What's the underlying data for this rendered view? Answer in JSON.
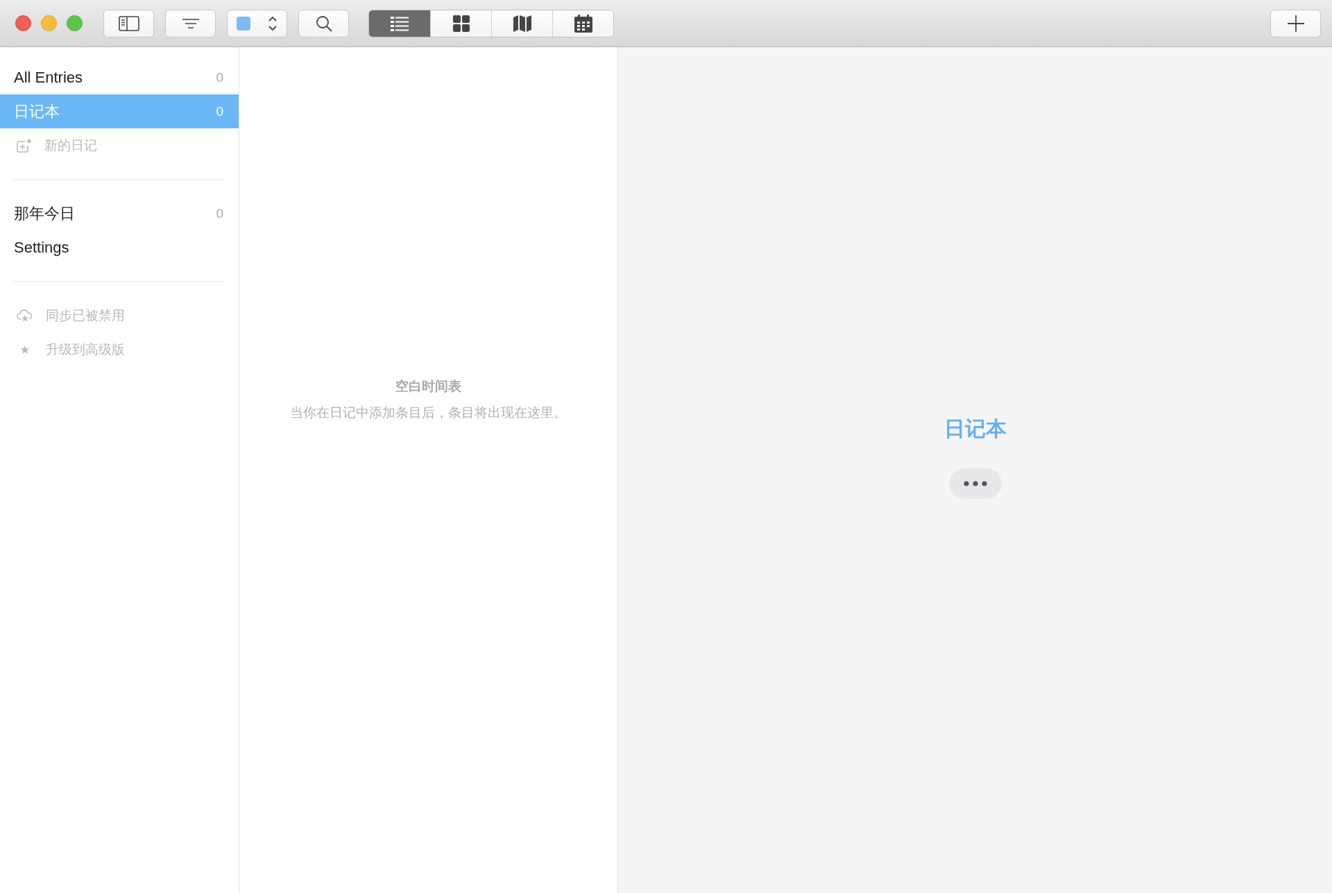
{
  "toolbar": {
    "view_tabs": [
      {
        "kind": "list",
        "selected": true
      },
      {
        "kind": "grid",
        "selected": false
      },
      {
        "kind": "map",
        "selected": false
      },
      {
        "kind": "calendar",
        "selected": false
      }
    ]
  },
  "sidebar": {
    "sections": [
      [
        {
          "kind": "nav",
          "label": "All Entries",
          "count": "0",
          "selected": false
        },
        {
          "kind": "nav",
          "label": "日记本",
          "count": "0",
          "selected": true
        },
        {
          "kind": "add",
          "label": "新的日记"
        }
      ],
      [
        {
          "kind": "nav",
          "label": "那年今日",
          "count": "0",
          "selected": false
        },
        {
          "kind": "nav",
          "label": "Settings",
          "selected": false
        }
      ],
      [
        {
          "kind": "sync",
          "label": "同步已被禁用"
        },
        {
          "kind": "upgrade",
          "label": "升级到高级版"
        }
      ]
    ]
  },
  "timeline": {
    "title": "空白时间表",
    "message": "当你在日记中添加条目后，条目将出现在这里。"
  },
  "detail": {
    "title": "日记本"
  }
}
